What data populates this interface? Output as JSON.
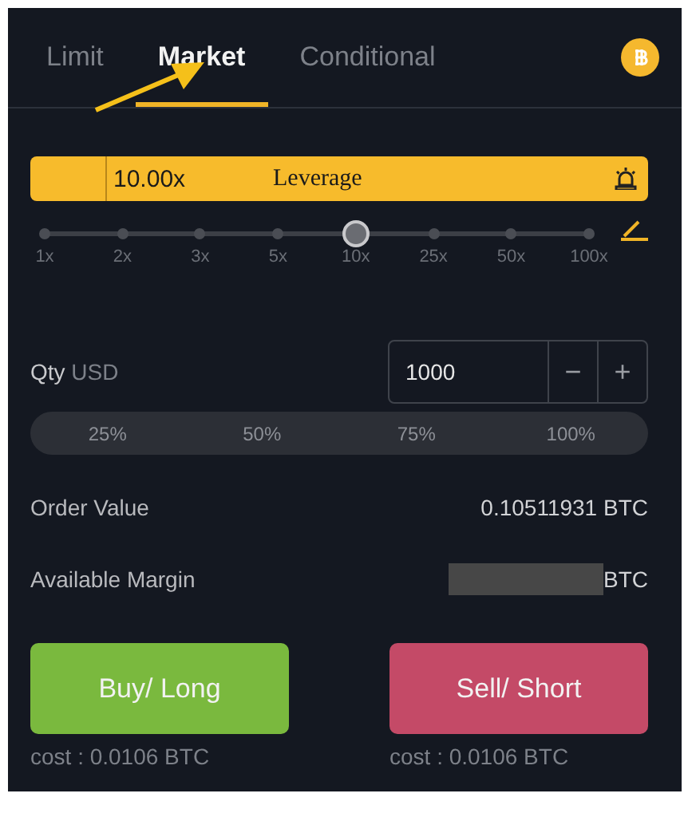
{
  "tabs": [
    {
      "label": "Limit",
      "selected": false
    },
    {
      "label": "Market",
      "selected": true
    },
    {
      "label": "Conditional",
      "selected": false
    }
  ],
  "leverage": {
    "value": "10.00x",
    "label": "Leverage",
    "level": 0.571,
    "ticks": [
      "1x",
      "2x",
      "3x",
      "5x",
      "10x",
      "25x",
      "50x",
      "100x"
    ]
  },
  "qty": {
    "label": "Qty",
    "unit": "USD",
    "value": "1000",
    "minus": "−",
    "plus": "+"
  },
  "percent_buttons": [
    "25%",
    "50%",
    "75%",
    "100%"
  ],
  "order_value": {
    "label": "Order Value",
    "value": "0.10511931 BTC"
  },
  "available_margin": {
    "label": "Available Margin",
    "redacted": true,
    "unit": "BTC"
  },
  "actions": [
    {
      "label": "Buy/ Long",
      "kind": "buy",
      "cost": "cost : 0.0106 BTC"
    },
    {
      "label": "Sell/ Short",
      "kind": "sell",
      "cost": "cost : 0.0106 BTC"
    }
  ],
  "annotation": {
    "kind": "arrow"
  }
}
